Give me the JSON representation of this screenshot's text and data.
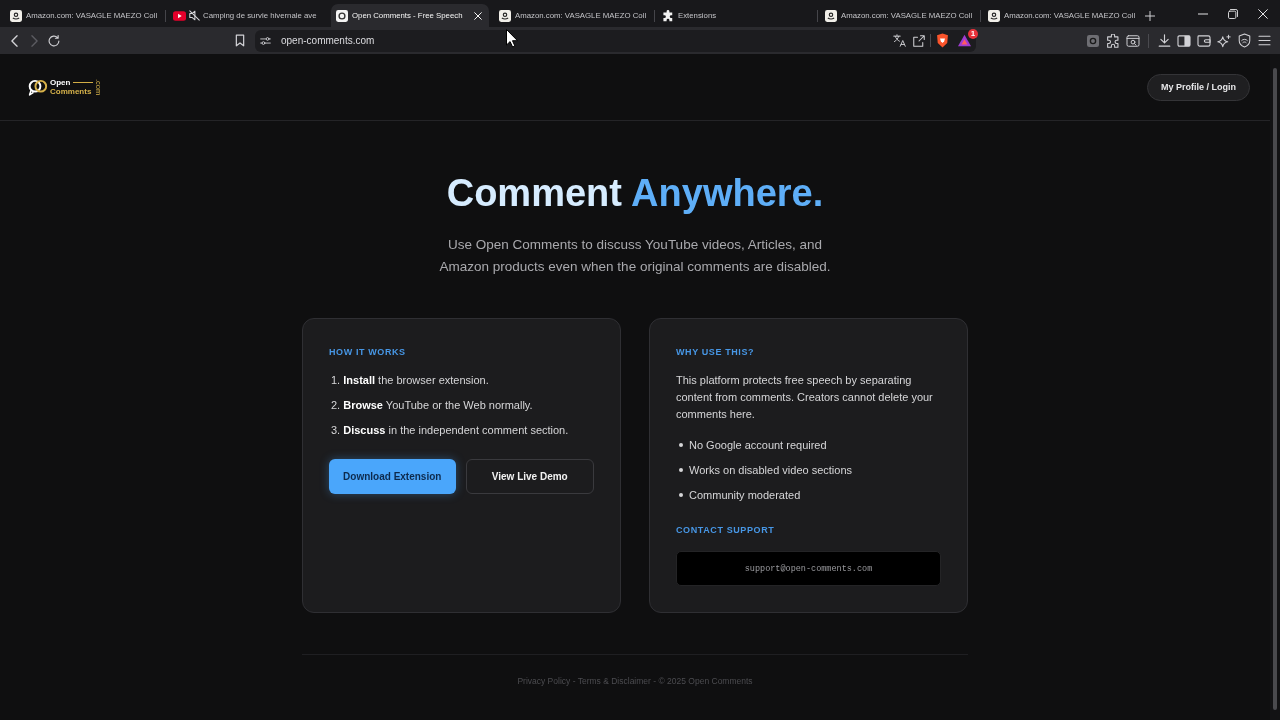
{
  "browser": {
    "tabs": [
      {
        "title": "Amazon.com: VASAGLE MAEZO Coll",
        "kind": "store",
        "selected": false,
        "muted": false
      },
      {
        "title": "Camping de survie hivernale ave",
        "kind": "video",
        "selected": false,
        "muted": true
      },
      {
        "title": "Open Comments - Free Speech",
        "kind": "site",
        "selected": true,
        "muted": false
      },
      {
        "title": "Amazon.com: VASAGLE MAEZO Coll",
        "kind": "store",
        "selected": false,
        "muted": false
      },
      {
        "title": "Extensions",
        "kind": "extensions",
        "selected": false,
        "muted": false
      },
      {
        "title": "Amazon.com: VASAGLE MAEZO Coll",
        "kind": "store",
        "selected": false,
        "muted": false
      },
      {
        "title": "Amazon.com: VASAGLE MAEZO Coll",
        "kind": "store",
        "selected": false,
        "muted": false
      }
    ],
    "nav": {
      "back_disabled": false,
      "forward_disabled": true
    },
    "address": "open-comments.com",
    "rewards_badge": "1"
  },
  "header": {
    "logo": {
      "top": "Open",
      "bottom": "Comments",
      "suffix": ".com"
    },
    "login_button": "My Profile / Login"
  },
  "hero": {
    "title": [
      {
        "text": "Comment",
        "kind": "plain"
      },
      {
        "text": "Anywhere.",
        "kind": "accent"
      }
    ],
    "subtitle": "Use Open Comments to discuss YouTube videos, Articles, and Amazon products even when the original comments are disabled."
  },
  "cards": [
    {
      "kind": "steps",
      "heading": "HOW IT WORKS",
      "steps": [
        {
          "number": "1.",
          "text": "**Install** the browser extension."
        },
        {
          "number": "2.",
          "text": "**Browse** YouTube or the Web normally."
        },
        {
          "number": "3.",
          "text": "**Discuss** in the independent comment section."
        }
      ],
      "buttons": [
        {
          "label": "Download Extension",
          "kind": "primary"
        },
        {
          "label": "View Live Demo",
          "kind": "secondary"
        }
      ]
    },
    {
      "kind": "reasons",
      "heading": "WHY USE THIS?",
      "paragraph": "This platform protects free speech by separating content from comments. Creators cannot delete your comments here.",
      "bullets": [
        "No Google account required",
        "Works on disabled video sections",
        "Community moderated"
      ],
      "contact": {
        "heading": "CONTACT SUPPORT",
        "email": "support@open-comments.com"
      }
    }
  ],
  "footer": {
    "text": "Privacy Policy - Terms & Disclaimer - © 2025 Open Comments"
  }
}
